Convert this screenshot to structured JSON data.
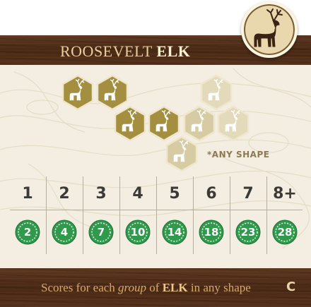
{
  "card": {
    "title_plain": "ROOSEVELT ",
    "title_bold": "ELK",
    "emblem": "elk-silhouette-icon",
    "pattern_note": "*ANY SHAPE",
    "groups": [
      "1",
      "2",
      "3",
      "4",
      "5",
      "6",
      "7",
      "8+"
    ],
    "points": [
      "2",
      "4",
      "7",
      "10",
      "14",
      "18",
      "23",
      "28"
    ],
    "footer_pre": "Scores for each ",
    "footer_italic": "group",
    "footer_mid": " of ",
    "footer_bold": "ELK",
    "footer_post": " in any shape",
    "set_letter": "C",
    "colors": {
      "wood": "#4a2915",
      "parchment": "#f3eee1",
      "hex_gold": "#a38f3f",
      "hex_faded": "#ddd4b3",
      "point_green": "#2f9a4b"
    }
  }
}
